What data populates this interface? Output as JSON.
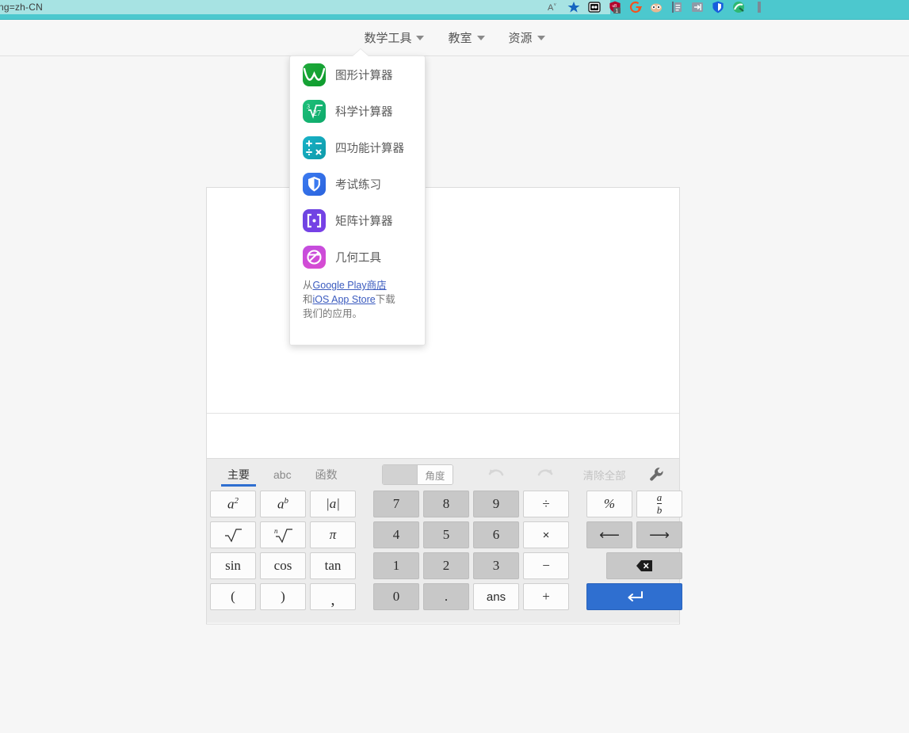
{
  "browser": {
    "url_fragment": "ng=zh-CN",
    "toolbar_icons": [
      {
        "name": "font-size-icon",
        "glyph": "A"
      },
      {
        "name": "favorites-star-icon",
        "glyph": "★"
      },
      {
        "name": "extension-dice-icon",
        "glyph": "⬛"
      },
      {
        "name": "extension-shield-icon",
        "glyph": "⬤",
        "badge": "1"
      },
      {
        "name": "extension-ghostery-icon",
        "glyph": "G"
      },
      {
        "name": "extension-privacy-badger-icon",
        "glyph": "👓"
      },
      {
        "name": "extension-clipboard-icon",
        "glyph": "▤"
      },
      {
        "name": "extension-export-icon",
        "glyph": "⇥"
      },
      {
        "name": "extension-bitwarden-icon",
        "glyph": "U"
      },
      {
        "name": "extension-grammar-icon",
        "glyph": "◉"
      },
      {
        "name": "extension-more-icon",
        "glyph": "▮"
      }
    ]
  },
  "nav": {
    "items": [
      {
        "label": "数学工具",
        "name": "math-tools"
      },
      {
        "label": "教室",
        "name": "classroom"
      },
      {
        "label": "资源",
        "name": "resources"
      }
    ]
  },
  "dropdown": {
    "items": [
      {
        "label": "图形计算器",
        "icon": "graphing-calculator-icon",
        "glyph": "∿"
      },
      {
        "label": "科学计算器",
        "icon": "scientific-calculator-icon",
        "glyph": "∛27"
      },
      {
        "label": "四功能计算器",
        "icon": "four-function-calculator-icon",
        "glyph": "+−÷×"
      },
      {
        "label": "考试练习",
        "icon": "exam-practice-shield-icon",
        "glyph": "🛡"
      },
      {
        "label": "矩阵计算器",
        "icon": "matrix-calculator-icon",
        "glyph": "[∙]"
      },
      {
        "label": "几何工具",
        "icon": "geometry-tool-icon",
        "glyph": "⊘"
      }
    ],
    "footer": {
      "prefix": "从",
      "link1": "Google Play",
      "mid1": "商店",
      "mid2": "和",
      "link2": "iOS App Store",
      "suffix": "下载我们的应用。"
    }
  },
  "keypad": {
    "tabs": [
      {
        "label": "主要",
        "active": true
      },
      {
        "label": "abc",
        "active": false
      },
      {
        "label": "函数",
        "active": false
      }
    ],
    "angle_toggle_label": "角度",
    "clear_all_label": "清除全部",
    "undo_icon": "undo-arrow-icon",
    "redo_icon": "redo-arrow-icon",
    "settings_icon": "wrench-icon",
    "left_keys": [
      {
        "label": "a2",
        "kind": "func",
        "name": "key-square"
      },
      {
        "label": "ab",
        "kind": "func",
        "name": "key-power"
      },
      {
        "label": "|a|",
        "kind": "func",
        "name": "key-abs"
      },
      {
        "label": "√",
        "kind": "func",
        "name": "key-sqrt"
      },
      {
        "label": "n√",
        "kind": "func",
        "name": "key-nth-root"
      },
      {
        "label": "π",
        "kind": "func",
        "name": "key-pi"
      },
      {
        "label": "sin",
        "kind": "func",
        "name": "key-sin"
      },
      {
        "label": "cos",
        "kind": "func",
        "name": "key-cos"
      },
      {
        "label": "tan",
        "kind": "func",
        "name": "key-tan"
      },
      {
        "label": "(",
        "kind": "func",
        "name": "key-open-paren"
      },
      {
        "label": ")",
        "kind": "func",
        "name": "key-close-paren"
      },
      {
        "label": ",",
        "kind": "func",
        "name": "key-comma"
      }
    ],
    "number_keys": [
      {
        "label": "7",
        "kind": "num",
        "name": "key-7"
      },
      {
        "label": "8",
        "kind": "num",
        "name": "key-8"
      },
      {
        "label": "9",
        "kind": "num",
        "name": "key-9"
      },
      {
        "label": "÷",
        "kind": "op",
        "name": "key-divide"
      },
      {
        "label": "4",
        "kind": "num",
        "name": "key-4"
      },
      {
        "label": "5",
        "kind": "num",
        "name": "key-5"
      },
      {
        "label": "6",
        "kind": "num",
        "name": "key-6"
      },
      {
        "label": "×",
        "kind": "op",
        "name": "key-multiply"
      },
      {
        "label": "1",
        "kind": "num",
        "name": "key-1"
      },
      {
        "label": "2",
        "kind": "num",
        "name": "key-2"
      },
      {
        "label": "3",
        "kind": "num",
        "name": "key-3"
      },
      {
        "label": "−",
        "kind": "op",
        "name": "key-minus"
      },
      {
        "label": "0",
        "kind": "num",
        "name": "key-0"
      },
      {
        "label": ".",
        "kind": "num",
        "name": "key-decimal"
      },
      {
        "label": "ans",
        "kind": "op",
        "name": "key-ans"
      },
      {
        "label": "+",
        "kind": "op",
        "name": "key-plus"
      }
    ],
    "right_keys": [
      {
        "label": "%",
        "kind": "op",
        "name": "key-percent"
      },
      {
        "label": "a/b",
        "kind": "op",
        "name": "key-fraction"
      },
      {
        "label": "←",
        "kind": "gray",
        "name": "key-arrow-left"
      },
      {
        "label": "→",
        "kind": "gray",
        "name": "key-arrow-right"
      },
      {
        "label": "⌫",
        "kind": "gray",
        "name": "key-backspace"
      },
      {
        "label": "↵",
        "kind": "blue",
        "name": "key-enter"
      }
    ]
  },
  "colors": {
    "teal": "#4cc8ce",
    "teal_light": "#a7e3e3",
    "accent_blue": "#2f6fd0",
    "key_gray": "#c8c8c8",
    "link_blue": "#3b5bbf"
  }
}
